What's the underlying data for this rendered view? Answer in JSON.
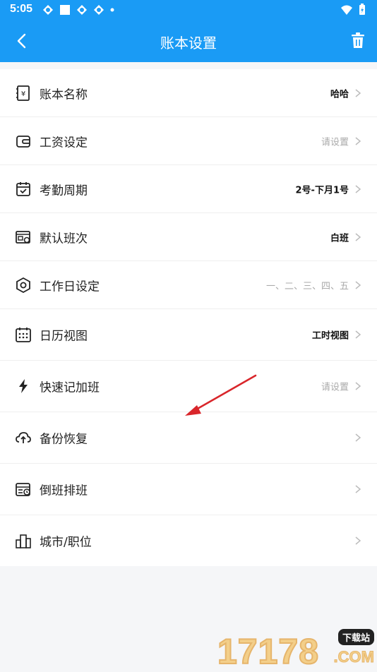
{
  "status": {
    "time": "5:05"
  },
  "header": {
    "title": "账本设置"
  },
  "rows": [
    {
      "label": "账本名称",
      "value": "哈哈",
      "muted": false,
      "icon": "ledger-icon"
    },
    {
      "label": "工资设定",
      "value": "请设置",
      "muted": true,
      "icon": "wallet-icon"
    },
    {
      "label": "考勤周期",
      "value": "2号-下月1号",
      "muted": false,
      "icon": "calendar-check-icon"
    },
    {
      "label": "默认班次",
      "value": "白班",
      "muted": false,
      "icon": "shift-icon"
    },
    {
      "label": "工作日设定",
      "value": "一、二、三、四、五",
      "muted": true,
      "icon": "hexagon-nut-icon"
    },
    {
      "label": "日历视图",
      "value": "工时视图",
      "muted": false,
      "icon": "calendar-grid-icon"
    },
    {
      "label": "快速记加班",
      "value": "请设置",
      "muted": true,
      "icon": "lightning-icon"
    },
    {
      "label": "备份恢复",
      "value": "",
      "muted": false,
      "icon": "cloud-upload-icon"
    },
    {
      "label": "倒班排班",
      "value": "",
      "muted": false,
      "icon": "schedule-icon"
    },
    {
      "label": "城市/职位",
      "value": "",
      "muted": false,
      "icon": "city-icon"
    }
  ],
  "watermark": {
    "number": "17178",
    "tag": "下载站",
    "domain": ".COM"
  },
  "colors": {
    "primary": "#1a9bf5",
    "arrow": "#d9262b"
  }
}
